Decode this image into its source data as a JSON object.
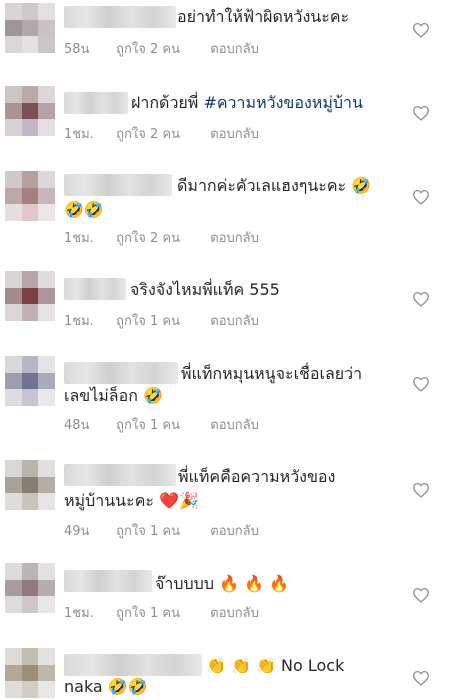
{
  "comments": [
    {
      "text": "อย่าทำให้ฟ้าผิดหวังนะคะ",
      "time": "58น",
      "likes": "ถูกใจ 2 คน",
      "reply": "ตอบกลับ"
    },
    {
      "text_prefix": "ฝากด้วยพี่ ",
      "hashtag": "#ความหวังของหมู่บ้าน",
      "time": "1ชม.",
      "likes": "ถูกใจ 2 คน",
      "reply": "ตอบกลับ"
    },
    {
      "text": "ดีมากค่ะคัวเลแฮงๆนะคะ 🤣",
      "text_line2": "🤣🤣",
      "time": "1ชม.",
      "likes": "ถูกใจ 2 คน",
      "reply": "ตอบกลับ"
    },
    {
      "text": "จริงจังไหมพี่แท็ค 555",
      "time": "1ชม.",
      "likes": "ถูกใจ 1 คน",
      "reply": "ตอบกลับ"
    },
    {
      "text": "พี่แท็กหมุนหนูจะเชื่อเลยว่า",
      "text_line2": "เลขไม่ล็อก 🤣",
      "time": "48น",
      "likes": "ถูกใจ 1 คน",
      "reply": "ตอบกลับ"
    },
    {
      "text": "พี่แท็คคือความหวังของ",
      "text_line2": "หมู่บ้านนะคะ ❤️🎉",
      "time": "49น",
      "likes": "ถูกใจ 1 คน",
      "reply": "ตอบกลับ"
    },
    {
      "text": "จ๊าบบบบ 🔥 🔥 🔥",
      "time": "1ชม.",
      "likes": "ถูกใจ 1 คน",
      "reply": "ตอบกลับ"
    },
    {
      "text": "👏 👏 👏 No Lock",
      "text_line2": "naka 🤣🤣"
    }
  ],
  "icons": {
    "like": "heart-outline-icon"
  },
  "colors": {
    "meta": "#8e8e8e",
    "hashtag": "#0b3a6e",
    "heart": "#8e8e8e"
  }
}
